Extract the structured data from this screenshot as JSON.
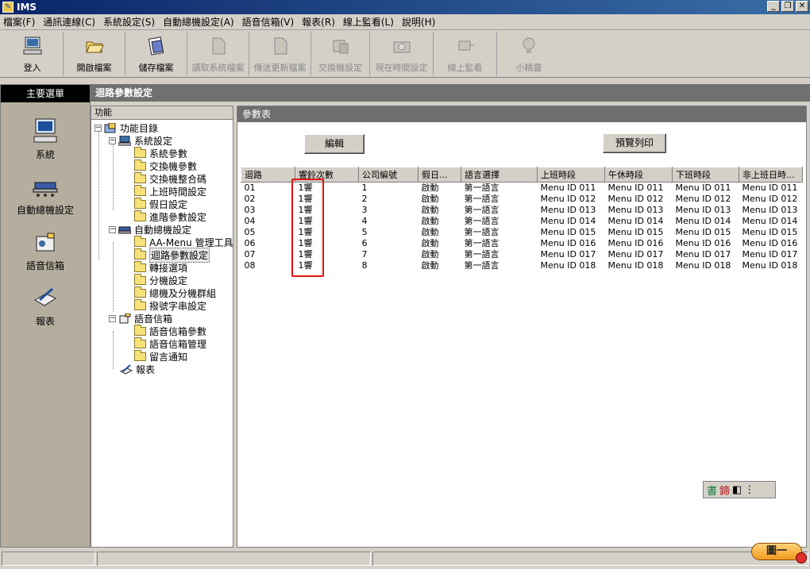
{
  "window": {
    "title": "IMS"
  },
  "menu": [
    "檔案(F)",
    "通訊連線(C)",
    "系統設定(S)",
    "自動總機設定(A)",
    "語音信箱(V)",
    "報表(R)",
    "線上監看(L)",
    "說明(H)"
  ],
  "toolbar": [
    {
      "label": "登入",
      "icon": "computer-icon",
      "enabled": true
    },
    {
      "label": "開啟檔案",
      "icon": "folder-open-icon",
      "enabled": true
    },
    {
      "label": "儲存檔案",
      "icon": "save-document-icon",
      "enabled": true
    },
    {
      "label": "讀取系統檔案",
      "icon": "file-read-icon",
      "enabled": false
    },
    {
      "label": "傳送更新檔案",
      "icon": "file-send-icon",
      "enabled": false
    },
    {
      "label": "交換機設定",
      "icon": "switch-icon",
      "enabled": false
    },
    {
      "label": "現在時間設定",
      "icon": "clock-camera-icon",
      "enabled": false
    },
    {
      "label": "線上監看",
      "icon": "monitor-plug-icon",
      "enabled": false
    },
    {
      "label": "小精靈",
      "icon": "lightbulb-icon",
      "enabled": false
    }
  ],
  "sidebar": {
    "title": "主要選單",
    "items": [
      {
        "label": "系統",
        "icon": "computer-icon"
      },
      {
        "label": "自動總機設定",
        "icon": "switchboard-icon"
      },
      {
        "label": "語音信箱",
        "icon": "voicemail-icon"
      },
      {
        "label": "報表",
        "icon": "report-icon"
      }
    ]
  },
  "main": {
    "title": "迴路參數設定"
  },
  "tree": {
    "label": "功能",
    "root": "功能目錄",
    "system": {
      "label": "系統設定",
      "children": [
        "系統參數",
        "交換機參數",
        "交換機整合碼",
        "上班時間設定",
        "假日設定",
        "進階參數設定"
      ]
    },
    "auto": {
      "label": "自動總機設定",
      "children": [
        "AA-Menu 管理工具",
        "迴路參數設定",
        "轉接選項",
        "分機設定",
        "總機及分機群組",
        "撥號字串設定"
      ]
    },
    "voice": {
      "label": "語音信箱",
      "children": [
        "語音信箱參數",
        "語音信箱管理",
        "留言通知"
      ]
    },
    "report": "報表"
  },
  "content": {
    "header": "參數表",
    "edit_button": "編輯",
    "print_button": "預覽列印",
    "columns": [
      "迴路",
      "響鈴次數",
      "公司編號",
      "假日...",
      "語言選擇",
      "上班時段",
      "午休時段",
      "下班時段",
      "非上班日時..."
    ],
    "rows": [
      [
        "01",
        "1響",
        "1",
        "啟動",
        "第一語言",
        "Menu ID 011",
        "Menu ID 011",
        "Menu ID 011",
        "Menu ID 011"
      ],
      [
        "02",
        "1響",
        "2",
        "啟動",
        "第一語言",
        "Menu ID 012",
        "Menu ID 012",
        "Menu ID 012",
        "Menu ID 012"
      ],
      [
        "03",
        "1響",
        "3",
        "啟動",
        "第一語言",
        "Menu ID 013",
        "Menu ID 013",
        "Menu ID 013",
        "Menu ID 013"
      ],
      [
        "04",
        "1響",
        "4",
        "啟動",
        "第一語言",
        "Menu ID 014",
        "Menu ID 014",
        "Menu ID 014",
        "Menu ID 014"
      ],
      [
        "05",
        "1響",
        "5",
        "啟動",
        "第一語言",
        "Menu ID 015",
        "Menu ID 015",
        "Menu ID 015",
        "Menu ID 015"
      ],
      [
        "06",
        "1響",
        "6",
        "啟動",
        "第一語言",
        "Menu ID 016",
        "Menu ID 016",
        "Menu ID 016",
        "Menu ID 016"
      ],
      [
        "07",
        "1響",
        "7",
        "啟動",
        "第一語言",
        "Menu ID 017",
        "Menu ID 017",
        "Menu ID 017",
        "Menu ID 017"
      ],
      [
        "08",
        "1響",
        "8",
        "啟動",
        "第一語言",
        "Menu ID 018",
        "Menu ID 018",
        "Menu ID 018",
        "Menu ID 018"
      ]
    ]
  },
  "ime": {
    "glyph1": "書",
    "glyph2": "鍗"
  },
  "bottom_button": "圖一"
}
